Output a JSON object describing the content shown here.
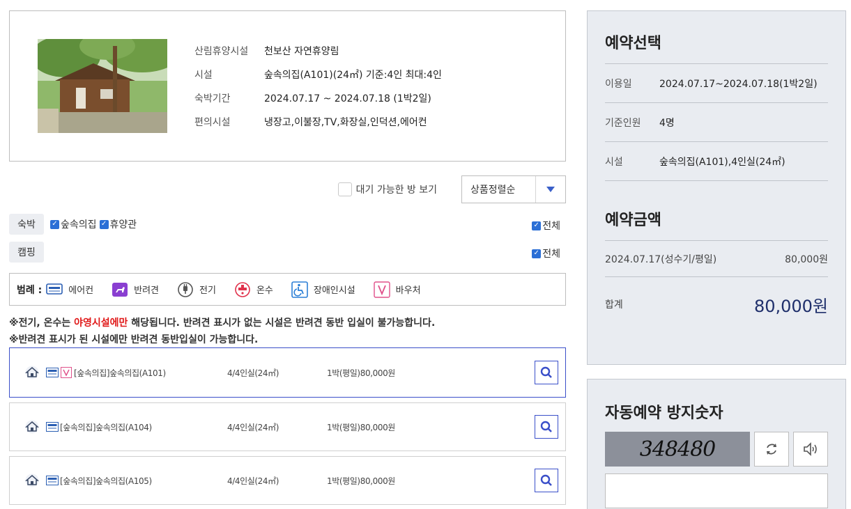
{
  "facility": {
    "rows": [
      {
        "key": "산림휴양시설",
        "value": "천보산 자연휴양림"
      },
      {
        "key": "시설",
        "value": "숲속의집(A101)(24㎡) 기준:4인 최대:4인"
      },
      {
        "key": "숙박기간",
        "value": "2024.07.17 ~ 2024.07.18 (1박2일)"
      },
      {
        "key": "편의시설",
        "value": "냉장고,이불장,TV,화장실,인덕션,에어컨"
      }
    ]
  },
  "filter": {
    "wait_label": "대기 가능한 방 보기",
    "sort_label": "상품정렬순"
  },
  "categories": {
    "lodging": {
      "tag": "숙박",
      "options": [
        "숲속의집",
        "휴양관"
      ],
      "all_label": "전체"
    },
    "camping": {
      "tag": "캠핑",
      "all_label": "전체"
    }
  },
  "legend": {
    "title": "범례 :",
    "items": [
      {
        "label": "에어컨",
        "icon": "aircon-icon",
        "color": "#2b5fb3"
      },
      {
        "label": "반려견",
        "icon": "pet-icon",
        "color": "#8a3fd1"
      },
      {
        "label": "전기",
        "icon": "plug-icon",
        "color": "#555555"
      },
      {
        "label": "온수",
        "icon": "hot-water-icon",
        "color": "#e0314b"
      },
      {
        "label": "장애인시설",
        "icon": "wheelchair-icon",
        "color": "#2b7fd6"
      },
      {
        "label": "바우처",
        "icon": "voucher-icon",
        "color": "#e0508a"
      }
    ]
  },
  "notes": {
    "line1_a": "※전기, 온수는 ",
    "line1_red": "야영시설에만",
    "line1_b": " 해당됩니다. 반려견 표시가 없는 시설은 반려견 동반 입실이 불가능합니다.",
    "line2": "※반려견 표시가 된 시설에만 반려견 동반입실이 가능합니다."
  },
  "rooms": [
    {
      "name": "[숲속의집]숲속의집(A101)",
      "capacity": "4/4인실(24㎡)",
      "price": "1박(평일)80,000원",
      "voucher": "V"
    },
    {
      "name": "[숲속의집]숲속의집(A104)",
      "capacity": "4/4인실(24㎡)",
      "price": "1박(평일)80,000원"
    },
    {
      "name": "[숲속의집]숲속의집(A105)",
      "capacity": "4/4인실(24㎡)",
      "price": "1박(평일)80,000원"
    }
  ],
  "reservation": {
    "title": "예약선택",
    "rows": [
      {
        "key": "이용일",
        "value": "2024.07.17~2024.07.18(1박2일)"
      },
      {
        "key": "기준인원",
        "value": "4명"
      },
      {
        "key": "시설",
        "value": "숲속의집(A101),4인실(24㎡)"
      }
    ]
  },
  "amount": {
    "title": "예약금액",
    "date_label": "2024.07.17(성수기/평일)",
    "date_price": "80,000원",
    "total_label": "합계",
    "total_value": "80,000원"
  },
  "captcha": {
    "title": "자동예약 방지숫자",
    "code": "348480"
  }
}
